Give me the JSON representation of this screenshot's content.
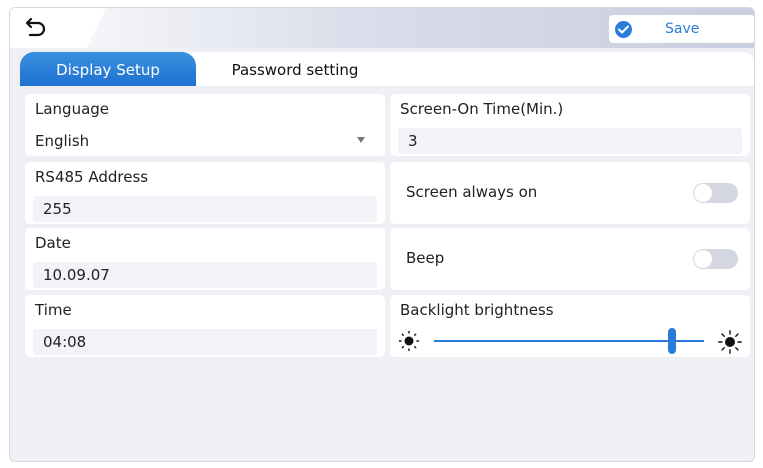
{
  "header": {
    "back_icon": "back-arrow-icon",
    "save_label": "Save",
    "save_icon": "check-circle-icon"
  },
  "tabs": [
    {
      "label": "Display Setup",
      "active": true
    },
    {
      "label": "Password setting",
      "active": false
    }
  ],
  "settings": {
    "language": {
      "label": "Language",
      "value": "English"
    },
    "rs485": {
      "label": "RS485 Address",
      "value": "255"
    },
    "date": {
      "label": "Date",
      "value": "10.09.07"
    },
    "time": {
      "label": "Time",
      "value": "04:08"
    },
    "screen_on_time": {
      "label": "Screen-On Time(Min.)",
      "value": "3"
    },
    "screen_always_on": {
      "label": "Screen always on",
      "enabled": false
    },
    "beep": {
      "label": "Beep",
      "enabled": false
    },
    "backlight": {
      "label": "Backlight brightness",
      "level_fraction": 0.88
    }
  },
  "colors": {
    "accent": "#2a7bdb",
    "toggle_off": "#d4d7e2",
    "panel_bg": "#eef0f6"
  }
}
